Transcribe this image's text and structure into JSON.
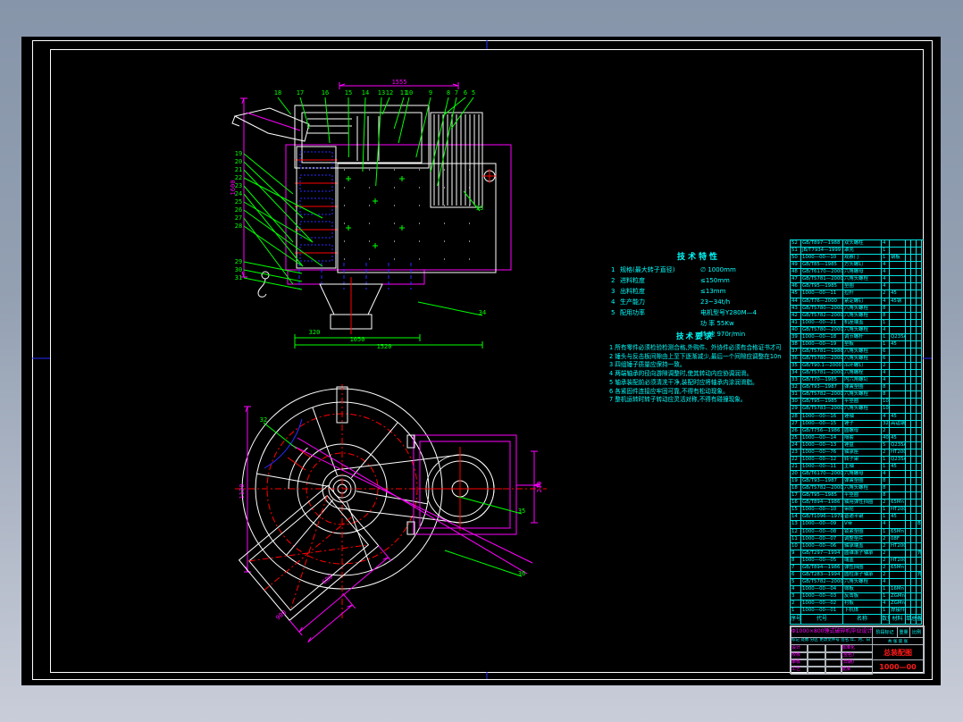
{
  "colors": {
    "background_top": "#8795aa",
    "background_bottom": "#c9cdd9",
    "paper": "#000000",
    "frame": "#ffffff",
    "outline": "#ff00ff",
    "dimension": "#00ff00",
    "text": "#00ffff",
    "center_line": "#ff0000",
    "hidden_line": "#2a2aff",
    "title_red": "#ff1a1a"
  },
  "tech_specs": {
    "title": "技术特性",
    "rows": [
      {
        "no": "1",
        "label": "规格(最大转子直径)",
        "value": "∅ 1000mm"
      },
      {
        "no": "2",
        "label": "进料粒度",
        "value": "≤150mm"
      },
      {
        "no": "3",
        "label": "出料粒度",
        "value": "≤13mm"
      },
      {
        "no": "4",
        "label": "生产能力",
        "value": "23~34t/h"
      },
      {
        "no": "5",
        "label": "配用功率",
        "value": "电机型号Y280M—4"
      },
      {
        "no": "",
        "label": "",
        "value": "功  率  55Kw"
      },
      {
        "no": "",
        "label": "",
        "value": "转  速  970r/min"
      }
    ]
  },
  "tech_requirements": {
    "title": "技术要求",
    "lines": [
      "1 所有零件必须检验检测合格,外购件、外协件必须有合格证书才可装配。",
      "2 锤头与反击板间隙由上至下逐渐减少,最后一个间隙应调整在10mm之内。",
      "3 四组锤子质量应保持一致。",
      "4 两端轴承的径向游隙调整时,使其转动内应协调润滑。",
      "5 轴承装配前必须清洗干净,装配时应将轴承内涂润滑脂。",
      "6 各紧固件连接应牢固可靠,不得有松动现象。",
      "7 整机运转时转子转动应灵活对称,不得有碰撞现象。"
    ]
  },
  "bom": {
    "headers": [
      "序号",
      "代号",
      "名称",
      "数量",
      "材料",
      "单件",
      "总计",
      "备注"
    ],
    "weight_label": "重量",
    "rows": [
      [
        "52",
        "GB/T897—1988",
        "双头螺柱",
        "4",
        "",
        ""
      ],
      [
        "51",
        "JB/T7934—1999",
        "罩壳",
        "1",
        "",
        ""
      ],
      [
        "50",
        "1000—00—10",
        "观察门",
        "1",
        "钢板",
        ""
      ],
      [
        "49",
        "GB/T85—1985",
        "方头螺钉",
        "4",
        "",
        ""
      ],
      [
        "48",
        "GB/T6170—2000",
        "六角螺母",
        "4",
        "",
        ""
      ],
      [
        "47",
        "GB/T5781—2000",
        "六角头螺栓",
        "4",
        "",
        ""
      ],
      [
        "46",
        "GB/T95—1985",
        "垫圈",
        "4",
        "",
        ""
      ],
      [
        "45",
        "1000—00—11",
        "拉杆",
        "2",
        "45",
        ""
      ],
      [
        "44",
        "GB/T76—2000",
        "紧定螺钉",
        "4",
        "45钢",
        ""
      ],
      [
        "43",
        "GB/T5780—2000",
        "六角头螺栓",
        "8",
        "",
        ""
      ],
      [
        "42",
        "GB/T5782—2000",
        "六角头螺栓",
        "8",
        "",
        ""
      ],
      [
        "41",
        "1000—00—21",
        "机座端盖",
        "1",
        "",
        ""
      ],
      [
        "40",
        "GB/T5780—2000",
        "六角头螺栓",
        "4",
        "",
        ""
      ],
      [
        "39",
        "1000—00—18",
        "调节螺杆",
        "1",
        "Q235A",
        ""
      ],
      [
        "38",
        "1000—00—19",
        "垫板",
        "1",
        "45",
        ""
      ],
      [
        "37",
        "GB/T5781—1986",
        "六角头螺栓",
        "6",
        "",
        ""
      ],
      [
        "36",
        "GB/T5780—2000",
        "六角头螺栓",
        "6",
        "",
        ""
      ],
      [
        "35",
        "GB/T90.1—2000",
        "吊环螺钉",
        "2",
        "",
        ""
      ],
      [
        "34",
        "GB/T5781—2000",
        "六角螺栓",
        "4",
        "",
        ""
      ],
      [
        "33",
        "GB/T70—1985",
        "内六角螺钉",
        "4",
        "",
        ""
      ],
      [
        "32",
        "GB/T93—1987",
        "弹簧垫圈",
        "8",
        "",
        ""
      ],
      [
        "31",
        "GB/T5782—2000",
        "六角头螺栓",
        "8",
        "",
        ""
      ],
      [
        "30",
        "GB/T95—1985",
        "平垫圈",
        "10",
        "",
        ""
      ],
      [
        "29",
        "GB/T5783—2000",
        "六角头螺栓",
        "10",
        "",
        ""
      ],
      [
        "28",
        "1000—00—16",
        "锤轴",
        "4",
        "45",
        ""
      ],
      [
        "27",
        "1000—00—15",
        "锤子",
        "32",
        "高锰钢",
        ""
      ],
      [
        "26",
        "GB/T756—1986",
        "圆螺母",
        "2",
        "",
        ""
      ],
      [
        "25",
        "1000—00—14",
        "隔套",
        "40",
        "45",
        ""
      ],
      [
        "24",
        "1000—00—13",
        "锤盘",
        "5",
        "Q235A",
        ""
      ],
      [
        "23",
        "1000—00—76",
        "轴承座",
        "2",
        "HT200",
        ""
      ],
      [
        "22",
        "1000—00—12",
        "转子架",
        "1",
        "Q235A",
        ""
      ],
      [
        "21",
        "1000—00—11",
        "主轴",
        "1",
        "45",
        ""
      ],
      [
        "20",
        "GB/T6170—2000",
        "六角螺母",
        "4",
        "",
        ""
      ],
      [
        "19",
        "GB/T93—1987",
        "弹簧垫圈",
        "8",
        "",
        ""
      ],
      [
        "18",
        "GB/T5782—2000",
        "六角头螺栓",
        "8",
        "",
        ""
      ],
      [
        "17",
        "GB/T95—1985",
        "平垫圈",
        "8",
        "",
        ""
      ],
      [
        "16",
        "GB/T894—1986",
        "轴用弹性挡圈",
        "2",
        "65Mn",
        ""
      ],
      [
        "15",
        "1000—00—10",
        "带轮",
        "1",
        "HT200",
        ""
      ],
      [
        "14",
        "GB/T1096—1979",
        "普通平键",
        "1",
        "45",
        ""
      ],
      [
        "13",
        "1000—00—09",
        "V带",
        "4",
        "",
        "B型"
      ],
      [
        "12",
        "1000—00—08",
        "锁紧垫圈",
        "1",
        "65Mn",
        ""
      ],
      [
        "11",
        "1000—00—07",
        "调整垫片",
        "2",
        "08F",
        ""
      ],
      [
        "10",
        "1000—00—06",
        "轴承端盖",
        "2",
        "HT200",
        ""
      ],
      [
        "9",
        "GB/T297—1994",
        "圆锥滚子轴承",
        "2",
        "",
        "外购"
      ],
      [
        "8",
        "1000—00—05",
        "端盖",
        "2",
        "HT200",
        ""
      ],
      [
        "7",
        "GB/T894—1986",
        "弹性挡圈",
        "2",
        "65Mn",
        ""
      ],
      [
        "6",
        "GB/T283—1994",
        "圆柱滚子轴承",
        "2",
        "",
        "外购"
      ],
      [
        "5",
        "GB/T5782—2000",
        "六角头螺栓",
        "4",
        "",
        ""
      ],
      [
        "4",
        "1000—00—04",
        "筛板",
        "1",
        "16Mn",
        ""
      ],
      [
        "3",
        "1000—00—03",
        "反击板",
        "1",
        "ZGMn13",
        ""
      ],
      [
        "2",
        "1000—00—02",
        "衬板",
        "4",
        "ZGMn13",
        ""
      ],
      [
        "1",
        "1000—00—01",
        "下机体",
        "1",
        "焊接件",
        ""
      ]
    ]
  },
  "title_block": {
    "project": "Φ1000×800锤式破碎机毕业设计",
    "revision_header": "标记 处数 分区 更改文件号 签名 年、月、日",
    "roles": [
      "设计",
      "校核",
      "审核",
      "工艺"
    ],
    "aux_labels": [
      "标准化",
      "(签名)",
      "(日期)",
      "批准"
    ],
    "stage_label": "阶段标记",
    "weight_label": "重量",
    "scale_label": "比例",
    "sheets": "共 张 第 张",
    "drawing_name": "总装配图",
    "drawing_no": "1000—00"
  },
  "callouts": {
    "top": [
      "18",
      "17",
      "16",
      "15",
      "14",
      "13",
      "12",
      "11",
      "10",
      "9",
      "8",
      "7",
      "6",
      "5"
    ],
    "left": [
      "19",
      "20",
      "21",
      "22",
      "23",
      "24",
      "25",
      "26",
      "27",
      "28",
      "29",
      "30",
      "31"
    ],
    "extra": [
      "33",
      "34",
      "35",
      "36",
      "32"
    ]
  },
  "dimensions": {
    "top_view": [
      "1555",
      "1600",
      "320",
      "1050",
      "1520"
    ],
    "plan_view": [
      "680",
      "900",
      "210",
      "1120"
    ]
  }
}
